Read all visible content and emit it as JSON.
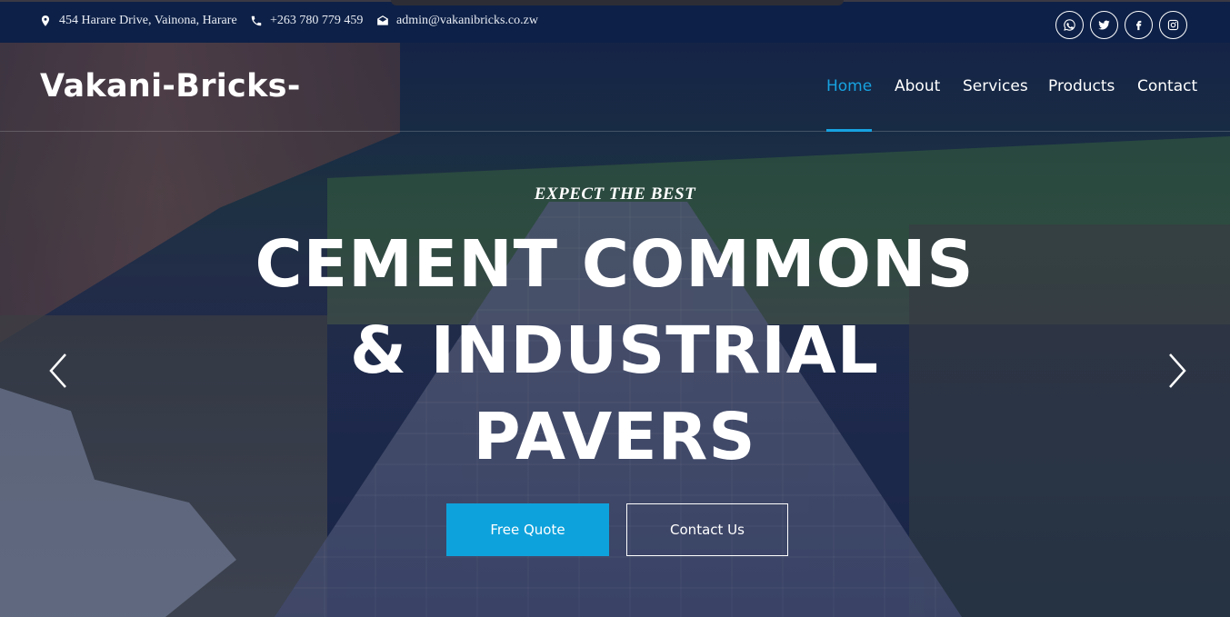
{
  "topbar": {
    "address": "454 Harare Drive, Vainona, Harare",
    "phone": "+263 780 779 459",
    "email": "admin@vakanibricks.co.zw",
    "social": [
      "whatsapp-icon",
      "twitter-icon",
      "facebook-icon",
      "instagram-icon"
    ]
  },
  "header": {
    "brand": "Vakani-Bricks-",
    "nav": [
      "Home",
      "About",
      "Services",
      "Products",
      "Contact"
    ],
    "active_nav": "Home"
  },
  "hero": {
    "eyebrow": "EXPECT THE BEST",
    "headline_line1": "CEMENT COMMONS",
    "headline_line2": "& INDUSTRIAL",
    "headline_line3": "PAVERS",
    "primary_button": "Free Quote",
    "secondary_button": "Contact Us"
  },
  "colors": {
    "accent": "#17a2e0",
    "topbar_bg": "#0d2047",
    "button_primary": "#0ea2dc"
  }
}
